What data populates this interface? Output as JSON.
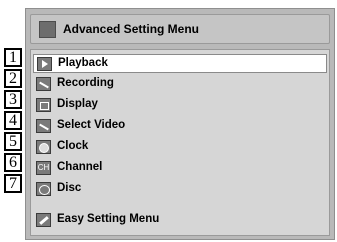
{
  "menu": {
    "title": "Advanced Setting Menu",
    "title_icon": "settings-menu-icon",
    "items": [
      {
        "number": "1",
        "label": "Playback",
        "icon": "play-icon",
        "selected": true
      },
      {
        "number": "2",
        "label": "Recording",
        "icon": "recording-icon",
        "selected": false
      },
      {
        "number": "3",
        "label": "Display",
        "icon": "display-icon",
        "selected": false
      },
      {
        "number": "4",
        "label": "Select Video",
        "icon": "video-select-icon",
        "selected": false
      },
      {
        "number": "5",
        "label": "Clock",
        "icon": "clock-icon",
        "selected": false
      },
      {
        "number": "6",
        "label": "Channel",
        "icon": "ch-icon",
        "icon_text": "CH",
        "selected": false
      },
      {
        "number": "7",
        "label": "Disc",
        "icon": "disc-icon",
        "selected": false
      }
    ],
    "footer_item": {
      "label": "Easy Setting Menu",
      "icon": "wrench-icon"
    }
  },
  "colors": {
    "background": "#b9b9b9",
    "selected_row": "#ffffff"
  }
}
